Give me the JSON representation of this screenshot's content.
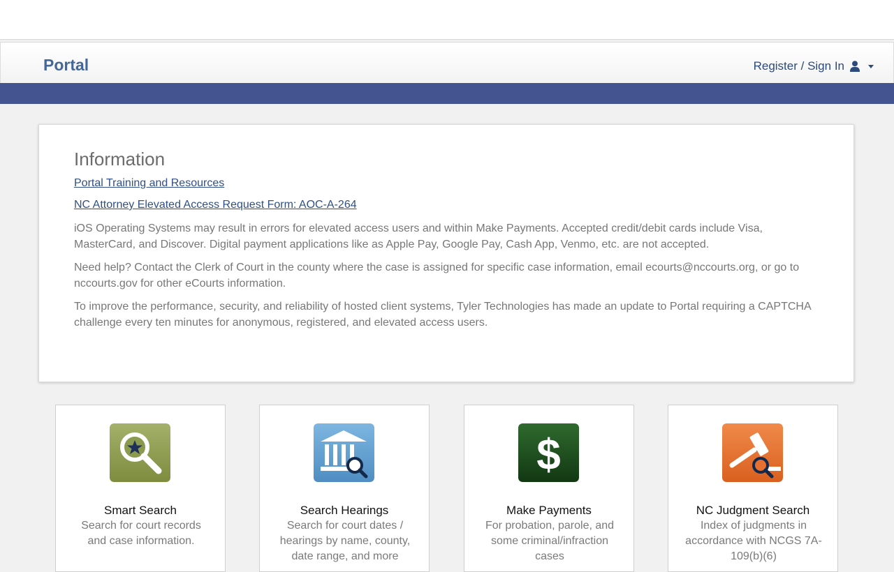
{
  "header": {
    "brand": "Portal",
    "signin_label": "Register / Sign In",
    "user_icon": "user-icon",
    "colors": {
      "brand": "#44679a",
      "band": "#445490"
    }
  },
  "info": {
    "title": "Information",
    "links": [
      "Portal Training and Resources",
      "NC Attorney Elevated Access Request Form: AOC-A-264"
    ],
    "paragraphs": [
      "iOS Operating Systems may result in errors for elevated access users and within Make Payments. Accepted credit/debit cards include Visa, MasterCard, and Discover. Digital payment applications like as Apple Pay, Google Pay, Cash App, Venmo, etc. are not accepted.",
      "Need help? Contact the Clerk of Court in the county where the case is assigned for specific case information, email ecourts@nccourts.org, or go to nccourts.gov for other eCourts information.",
      "To improve the performance, security, and reliability of hosted client systems, Tyler Technologies has made an update to Portal requiring a CAPTCHA challenge every ten minutes for anonymous, registered, and elevated access users."
    ]
  },
  "tiles": [
    {
      "title": "Smart Search",
      "desc": "Search for court records and case information.",
      "icon": "magnifier-star-icon",
      "color": "#8a9a4e"
    },
    {
      "title": "Search Hearings",
      "desc": "Search for court dates / hearings by name, county, date range, and more",
      "icon": "courthouse-search-icon",
      "color": "#5e9ccf"
    },
    {
      "title": "Make Payments",
      "desc": "For probation, parole, and some criminal/infraction cases",
      "icon": "dollar-icon",
      "color": "#1d4a1d"
    },
    {
      "title": "NC Judgment Search",
      "desc": "Index of judgments in accordance with NCGS 7A-109(b)(6)",
      "icon": "gavel-search-icon",
      "color": "#e5702f"
    }
  ]
}
